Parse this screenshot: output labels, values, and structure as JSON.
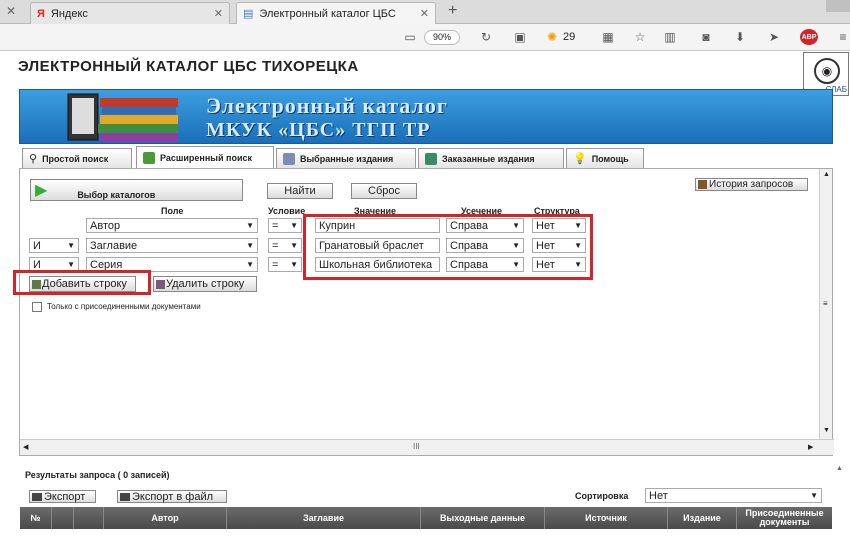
{
  "browser": {
    "tabs": [
      {
        "title": "Яндекс"
      },
      {
        "title": "Электронный каталог ЦБС"
      }
    ],
    "zoom": "90%",
    "weather_temp": "29"
  },
  "page": {
    "title": "ЭЛЕКТРОННЫЙ КАТАЛОГ ЦБС ТИХОРЕЦКА",
    "lens_label": "СЛАБ",
    "banner_line1": "Электронный каталог",
    "banner_line2": "МКУК «ЦБС» ТГП ТР"
  },
  "search_tabs": [
    {
      "label": "Простой поиск"
    },
    {
      "label": "Расширенный поиск"
    },
    {
      "label": "Выбранные издания"
    },
    {
      "label": "Заказанные издания"
    },
    {
      "label": "Помощь"
    }
  ],
  "panel": {
    "catalog_button": "Выбор каталогов",
    "find_button": "Найти",
    "reset_button": "Сброс",
    "history_button": "История запросов",
    "headers": {
      "field": "Поле",
      "condition": "Условие",
      "value": "Значение",
      "truncation": "Усечение",
      "structure": "Структура"
    },
    "rows": [
      {
        "logic": "",
        "field": "Автор",
        "condition": "=",
        "value": "Куприн",
        "truncation": "Справа",
        "structure": "Нет"
      },
      {
        "logic": "И",
        "field": "Заглавие",
        "condition": "=",
        "value": "Гранатовый браслет",
        "truncation": "Справа",
        "structure": "Нет"
      },
      {
        "logic": "И",
        "field": "Серия",
        "condition": "=",
        "value": "Школьная библиотека",
        "truncation": "Справа",
        "structure": "Нет"
      }
    ],
    "add_row_button": "Добавить строку",
    "delete_row_button": "Удалить строку",
    "attached_only_label": "Только с присоединенными документами",
    "hscroll_grip": "III"
  },
  "results": {
    "title": "Результаты запроса ( 0 записей)",
    "export_button": "Экспорт",
    "export_file_button": "Экспорт в файл",
    "sort_label": "Сортировка",
    "sort_value": "Нет",
    "columns": [
      "№",
      "",
      "",
      "Автор",
      "Заглавие",
      "Выходные данные",
      "Источник",
      "Издание",
      "Присоединенные документы"
    ]
  },
  "colors": {
    "accent_red": "#d4232b",
    "banner_blue": "#2a86d0"
  }
}
